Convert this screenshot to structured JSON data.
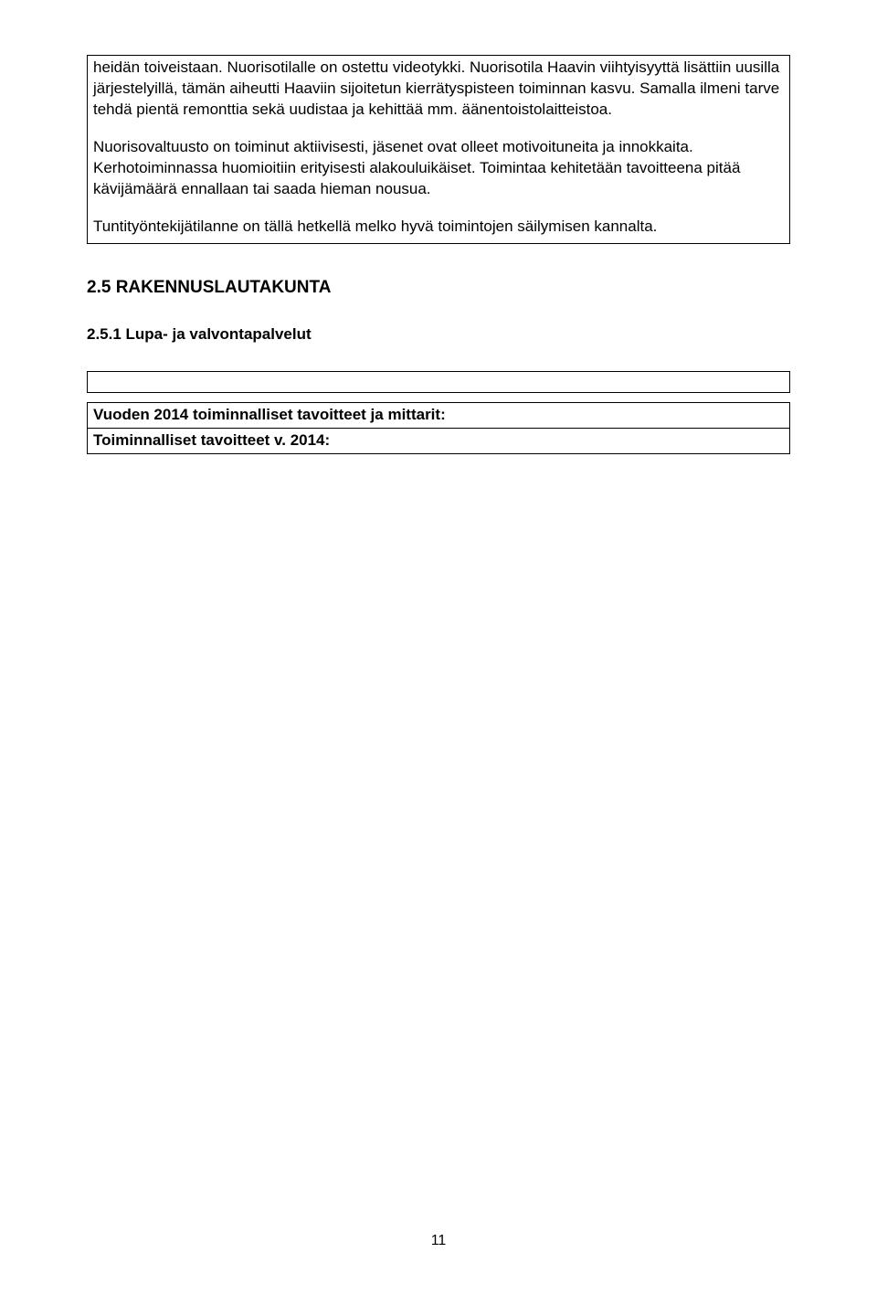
{
  "topBox": {
    "para1": "heidän toiveistaan. Nuorisotilalle on ostettu videotykki. Nuorisotila Haavin viihtyisyyttä lisättiin uusilla järjestelyillä, tämän aiheutti Haaviin sijoitetun kierrätyspisteen toiminnan kasvu. Samalla ilmeni tarve tehdä pientä remonttia sekä uudistaa ja kehittää mm. äänentoistolaitteistoa.",
    "para2": "Nuorisovaltuusto on toiminut aktiivisesti, jäsenet ovat olleet motivoituneita ja innokkaita. Kerhotoiminnassa huomioitiin erityisesti alakouluikäiset. Toimintaa kehitetään tavoitteena pitää kävijämäärä ennallaan tai saada hieman nousua.",
    "para3": "Tuntityöntekijätilanne on tällä hetkellä melko hyvä toimintojen säilymisen kannalta."
  },
  "headings": {
    "section": "2.5 RAKENNUSLAUTAKUNTA",
    "subsection": "2.5.1  Lupa- ja valvontapalvelut"
  },
  "bottomTable": {
    "headerRow": "Vuoden 2014 toiminnalliset tavoitteet ja mittarit:",
    "dataRow": "Toiminnalliset tavoitteet v. 2014:"
  },
  "pageNumber": "11"
}
